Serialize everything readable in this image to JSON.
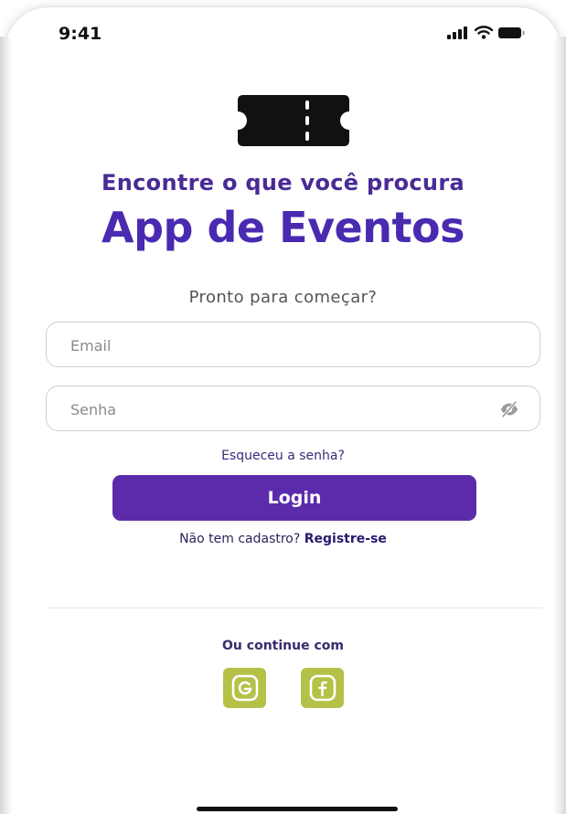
{
  "status_bar": {
    "time": "9:41",
    "icons": [
      "signal-icon",
      "wifi-icon",
      "battery-icon"
    ]
  },
  "logo": {
    "icon": "ticket-icon"
  },
  "header": {
    "tagline": "Encontre o que você procura",
    "title": "App de Eventos"
  },
  "form": {
    "subtitle": "Pronto para começar?",
    "email": {
      "placeholder": "Email",
      "value": ""
    },
    "password": {
      "placeholder": "Senha",
      "value": "",
      "toggle_icon": "eye-off-icon"
    },
    "forgot_label": "Esqueceu a senha?",
    "login_label": "Login",
    "register_prompt": "Não tem cadastro?",
    "register_link": "Registre-se"
  },
  "social": {
    "label": "Ou continue com",
    "buttons": [
      {
        "name": "google",
        "icon": "google-icon"
      },
      {
        "name": "facebook",
        "icon": "facebook-icon"
      }
    ]
  },
  "colors": {
    "primary": "#5b2bab",
    "title": "#4a2ab0",
    "tagline": "#4a2a96",
    "social_bg": "#b5c147"
  }
}
